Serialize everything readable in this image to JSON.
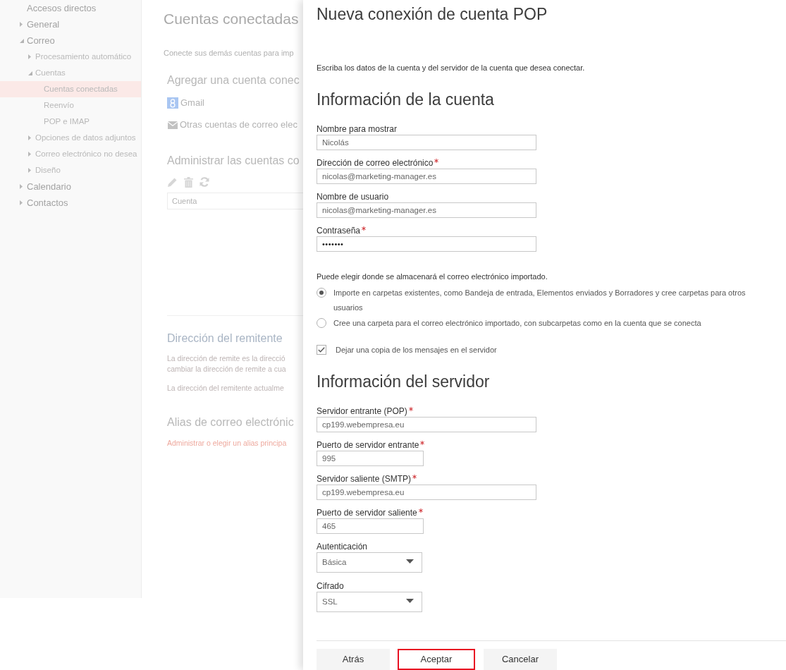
{
  "sidebar": {
    "items": [
      {
        "label": "Accesos directos",
        "selected": false
      },
      {
        "label": "General",
        "expanded": false,
        "selected": false
      },
      {
        "label": "Correo",
        "expanded": true,
        "selected": false,
        "children": [
          {
            "label": "Procesamiento automático",
            "expanded": false,
            "selected": false
          },
          {
            "label": "Cuentas",
            "expanded": true,
            "selected": false,
            "children": [
              {
                "label": "Cuentas conectadas",
                "selected": true
              },
              {
                "label": "Reenvío",
                "selected": false
              },
              {
                "label": "POP e IMAP",
                "selected": false
              }
            ]
          },
          {
            "label": "Opciones de datos adjuntos",
            "expanded": false,
            "selected": false
          },
          {
            "label": "Correo electrónico no desea",
            "expanded": false,
            "selected": false
          },
          {
            "label": "Diseño",
            "expanded": false,
            "selected": false
          }
        ]
      },
      {
        "label": "Calendario",
        "expanded": false,
        "selected": false
      },
      {
        "label": "Contactos",
        "expanded": false,
        "selected": false
      }
    ]
  },
  "settings_page": {
    "title": "Cuentas conectadas",
    "intro": "Conecte sus demás cuentas para imp",
    "add_heading": "Agregar una cuenta conec",
    "add_options": [
      {
        "kind": "gmail",
        "label": "Gmail"
      },
      {
        "kind": "other",
        "label": "Otras cuentas de correo elec"
      }
    ],
    "manage_heading": "Administrar las cuentas co",
    "table": {
      "columns": [
        "Cuenta"
      ]
    },
    "sender_heading": "Dirección del remitente",
    "sender_text_lines": [
      "La dirección de remite es la direcció",
      "cambiar la dirección de remite a cua"
    ],
    "sender_current": "La dirección del remitente actualme",
    "alias_heading": "Alias de correo electrónic",
    "alias_link": "Administrar o elegir un alias principa"
  },
  "dialog": {
    "title": "Nueva conexión de cuenta POP",
    "description": "Escriba los datos de la cuenta y del servidor de la cuenta que desea conectar.",
    "account_heading": "Información de la cuenta",
    "account_fields": [
      {
        "kind": "text",
        "label": "Nombre para mostrar",
        "required": false,
        "value": "Nicolás"
      },
      {
        "kind": "text",
        "label": "Dirección de correo electrónico",
        "required": true,
        "value": "nicolas@marketing-manager.es"
      },
      {
        "kind": "text",
        "label": "Nombre de usuario",
        "required": false,
        "value": "nicolas@marketing-manager.es"
      },
      {
        "kind": "password",
        "label": "Contraseña",
        "required": true,
        "value": "•••••••"
      }
    ],
    "storage_prompt": "Puede elegir donde se almacenará el correo electrónico importado.",
    "storage_options": [
      {
        "label": "Importe en carpetas existentes, como Bandeja de entrada, Elementos enviados y Borradores y cree carpetas para otros usuarios",
        "selected": true
      },
      {
        "label": "Cree una carpeta para el correo electrónico importado, con subcarpetas como en la cuenta que se conecta",
        "selected": false
      }
    ],
    "keep_copy": {
      "label": "Dejar una copia de los mensajes en el servidor",
      "checked": true
    },
    "server_heading": "Información del servidor",
    "server_fields": [
      {
        "kind": "text",
        "label": "Servidor entrante (POP)",
        "required": true,
        "value": "cp199.webempresa.eu"
      },
      {
        "kind": "short",
        "label": "Puerto de servidor entrante",
        "required": true,
        "value": "995"
      },
      {
        "kind": "text",
        "label": "Servidor saliente (SMTP)",
        "required": true,
        "value": "cp199.webempresa.eu"
      },
      {
        "kind": "short",
        "label": "Puerto de servidor saliente",
        "required": true,
        "value": "465"
      },
      {
        "kind": "select",
        "label": "Autenticación",
        "required": false,
        "value": "Básica"
      },
      {
        "kind": "select",
        "label": "Cifrado",
        "required": false,
        "value": "SSL"
      }
    ],
    "buttons": [
      {
        "label": "Atrás",
        "highlighted": false
      },
      {
        "label": "Aceptar",
        "highlighted": true
      },
      {
        "label": "Cancelar",
        "highlighted": false
      }
    ]
  }
}
